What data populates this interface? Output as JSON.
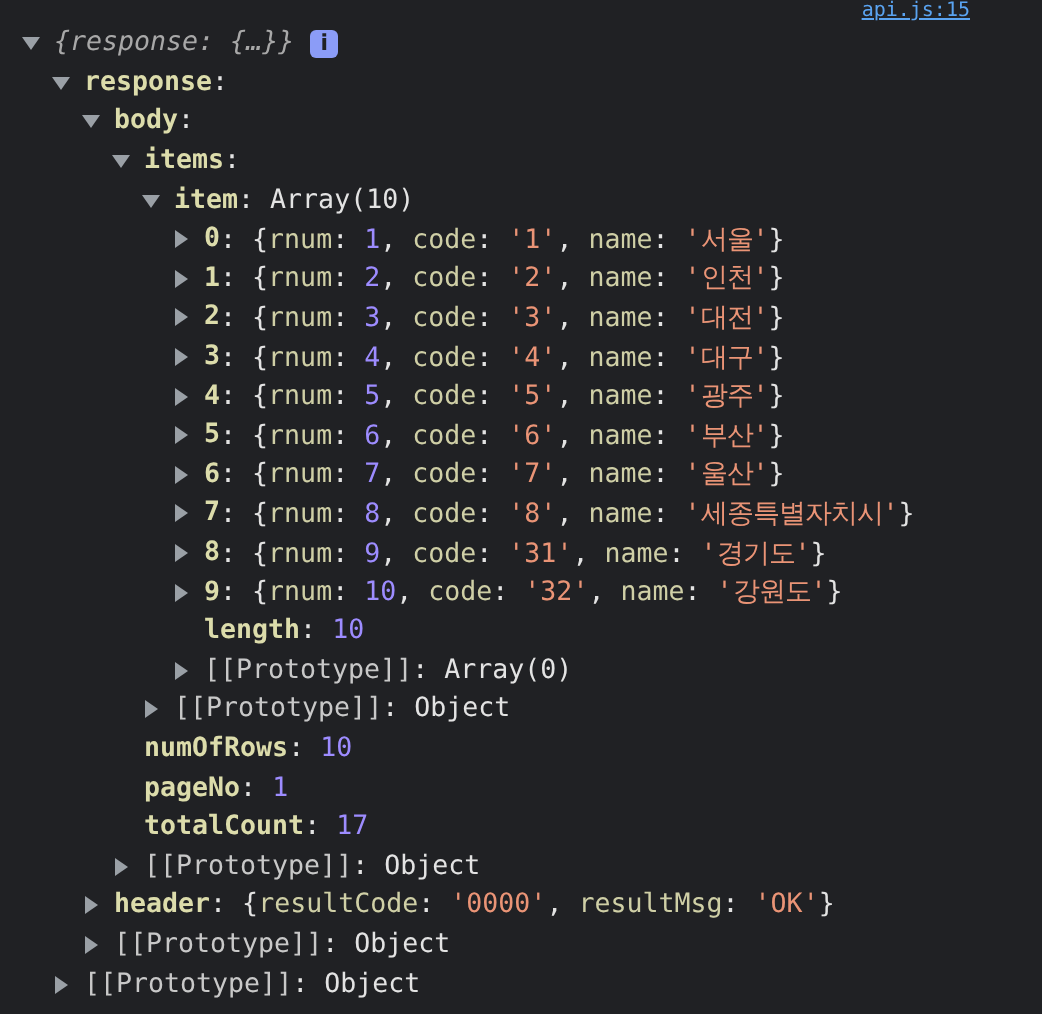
{
  "source_link": "api.js:15",
  "tree": {
    "summary": "{response: {…}}",
    "badge": "i",
    "expanded": true,
    "children": [
      {
        "kind": "node",
        "key": {
          "text": "response",
          "kind": "own"
        },
        "expanded": true,
        "value": [
          {
            "text": ":",
            "kind": "punct"
          }
        ],
        "children": [
          {
            "kind": "node",
            "key": {
              "text": "body",
              "kind": "own"
            },
            "expanded": true,
            "value": [
              {
                "text": ":",
                "kind": "punct"
              }
            ],
            "children": [
              {
                "kind": "node",
                "key": {
                  "text": "items",
                  "kind": "own"
                },
                "expanded": true,
                "value": [
                  {
                    "text": ":",
                    "kind": "punct"
                  }
                ],
                "children": [
                  {
                    "kind": "node",
                    "key": {
                      "text": "item",
                      "kind": "own"
                    },
                    "expanded": true,
                    "value": [
                      {
                        "text": ": Array(10)",
                        "kind": "punct"
                      }
                    ],
                    "children": [
                      {
                        "kind": "node",
                        "key": {
                          "text": "0",
                          "kind": "own"
                        },
                        "expanded": false,
                        "value": [
                          {
                            "text": ": {",
                            "kind": "punct"
                          },
                          {
                            "text": "rnum",
                            "kind": "prop"
                          },
                          {
                            "text": ": ",
                            "kind": "punct"
                          },
                          {
                            "text": "1",
                            "kind": "number"
                          },
                          {
                            "text": ", ",
                            "kind": "punct"
                          },
                          {
                            "text": "code",
                            "kind": "prop"
                          },
                          {
                            "text": ": ",
                            "kind": "punct"
                          },
                          {
                            "text": "'1'",
                            "kind": "string"
                          },
                          {
                            "text": ", ",
                            "kind": "punct"
                          },
                          {
                            "text": "name",
                            "kind": "prop"
                          },
                          {
                            "text": ": ",
                            "kind": "punct"
                          },
                          {
                            "text": "'서울'",
                            "kind": "string"
                          },
                          {
                            "text": "}",
                            "kind": "punct"
                          }
                        ]
                      },
                      {
                        "kind": "node",
                        "key": {
                          "text": "1",
                          "kind": "own"
                        },
                        "expanded": false,
                        "value": [
                          {
                            "text": ": {",
                            "kind": "punct"
                          },
                          {
                            "text": "rnum",
                            "kind": "prop"
                          },
                          {
                            "text": ": ",
                            "kind": "punct"
                          },
                          {
                            "text": "2",
                            "kind": "number"
                          },
                          {
                            "text": ", ",
                            "kind": "punct"
                          },
                          {
                            "text": "code",
                            "kind": "prop"
                          },
                          {
                            "text": ": ",
                            "kind": "punct"
                          },
                          {
                            "text": "'2'",
                            "kind": "string"
                          },
                          {
                            "text": ", ",
                            "kind": "punct"
                          },
                          {
                            "text": "name",
                            "kind": "prop"
                          },
                          {
                            "text": ": ",
                            "kind": "punct"
                          },
                          {
                            "text": "'인천'",
                            "kind": "string"
                          },
                          {
                            "text": "}",
                            "kind": "punct"
                          }
                        ]
                      },
                      {
                        "kind": "node",
                        "key": {
                          "text": "2",
                          "kind": "own"
                        },
                        "expanded": false,
                        "value": [
                          {
                            "text": ": {",
                            "kind": "punct"
                          },
                          {
                            "text": "rnum",
                            "kind": "prop"
                          },
                          {
                            "text": ": ",
                            "kind": "punct"
                          },
                          {
                            "text": "3",
                            "kind": "number"
                          },
                          {
                            "text": ", ",
                            "kind": "punct"
                          },
                          {
                            "text": "code",
                            "kind": "prop"
                          },
                          {
                            "text": ": ",
                            "kind": "punct"
                          },
                          {
                            "text": "'3'",
                            "kind": "string"
                          },
                          {
                            "text": ", ",
                            "kind": "punct"
                          },
                          {
                            "text": "name",
                            "kind": "prop"
                          },
                          {
                            "text": ": ",
                            "kind": "punct"
                          },
                          {
                            "text": "'대전'",
                            "kind": "string"
                          },
                          {
                            "text": "}",
                            "kind": "punct"
                          }
                        ]
                      },
                      {
                        "kind": "node",
                        "key": {
                          "text": "3",
                          "kind": "own"
                        },
                        "expanded": false,
                        "value": [
                          {
                            "text": ": {",
                            "kind": "punct"
                          },
                          {
                            "text": "rnum",
                            "kind": "prop"
                          },
                          {
                            "text": ": ",
                            "kind": "punct"
                          },
                          {
                            "text": "4",
                            "kind": "number"
                          },
                          {
                            "text": ", ",
                            "kind": "punct"
                          },
                          {
                            "text": "code",
                            "kind": "prop"
                          },
                          {
                            "text": ": ",
                            "kind": "punct"
                          },
                          {
                            "text": "'4'",
                            "kind": "string"
                          },
                          {
                            "text": ", ",
                            "kind": "punct"
                          },
                          {
                            "text": "name",
                            "kind": "prop"
                          },
                          {
                            "text": ": ",
                            "kind": "punct"
                          },
                          {
                            "text": "'대구'",
                            "kind": "string"
                          },
                          {
                            "text": "}",
                            "kind": "punct"
                          }
                        ]
                      },
                      {
                        "kind": "node",
                        "key": {
                          "text": "4",
                          "kind": "own"
                        },
                        "expanded": false,
                        "value": [
                          {
                            "text": ": {",
                            "kind": "punct"
                          },
                          {
                            "text": "rnum",
                            "kind": "prop"
                          },
                          {
                            "text": ": ",
                            "kind": "punct"
                          },
                          {
                            "text": "5",
                            "kind": "number"
                          },
                          {
                            "text": ", ",
                            "kind": "punct"
                          },
                          {
                            "text": "code",
                            "kind": "prop"
                          },
                          {
                            "text": ": ",
                            "kind": "punct"
                          },
                          {
                            "text": "'5'",
                            "kind": "string"
                          },
                          {
                            "text": ", ",
                            "kind": "punct"
                          },
                          {
                            "text": "name",
                            "kind": "prop"
                          },
                          {
                            "text": ": ",
                            "kind": "punct"
                          },
                          {
                            "text": "'광주'",
                            "kind": "string"
                          },
                          {
                            "text": "}",
                            "kind": "punct"
                          }
                        ]
                      },
                      {
                        "kind": "node",
                        "key": {
                          "text": "5",
                          "kind": "own"
                        },
                        "expanded": false,
                        "value": [
                          {
                            "text": ": {",
                            "kind": "punct"
                          },
                          {
                            "text": "rnum",
                            "kind": "prop"
                          },
                          {
                            "text": ": ",
                            "kind": "punct"
                          },
                          {
                            "text": "6",
                            "kind": "number"
                          },
                          {
                            "text": ", ",
                            "kind": "punct"
                          },
                          {
                            "text": "code",
                            "kind": "prop"
                          },
                          {
                            "text": ": ",
                            "kind": "punct"
                          },
                          {
                            "text": "'6'",
                            "kind": "string"
                          },
                          {
                            "text": ", ",
                            "kind": "punct"
                          },
                          {
                            "text": "name",
                            "kind": "prop"
                          },
                          {
                            "text": ": ",
                            "kind": "punct"
                          },
                          {
                            "text": "'부산'",
                            "kind": "string"
                          },
                          {
                            "text": "}",
                            "kind": "punct"
                          }
                        ]
                      },
                      {
                        "kind": "node",
                        "key": {
                          "text": "6",
                          "kind": "own"
                        },
                        "expanded": false,
                        "value": [
                          {
                            "text": ": {",
                            "kind": "punct"
                          },
                          {
                            "text": "rnum",
                            "kind": "prop"
                          },
                          {
                            "text": ": ",
                            "kind": "punct"
                          },
                          {
                            "text": "7",
                            "kind": "number"
                          },
                          {
                            "text": ", ",
                            "kind": "punct"
                          },
                          {
                            "text": "code",
                            "kind": "prop"
                          },
                          {
                            "text": ": ",
                            "kind": "punct"
                          },
                          {
                            "text": "'7'",
                            "kind": "string"
                          },
                          {
                            "text": ", ",
                            "kind": "punct"
                          },
                          {
                            "text": "name",
                            "kind": "prop"
                          },
                          {
                            "text": ": ",
                            "kind": "punct"
                          },
                          {
                            "text": "'울산'",
                            "kind": "string"
                          },
                          {
                            "text": "}",
                            "kind": "punct"
                          }
                        ]
                      },
                      {
                        "kind": "node",
                        "key": {
                          "text": "7",
                          "kind": "own"
                        },
                        "expanded": false,
                        "value": [
                          {
                            "text": ": {",
                            "kind": "punct"
                          },
                          {
                            "text": "rnum",
                            "kind": "prop"
                          },
                          {
                            "text": ": ",
                            "kind": "punct"
                          },
                          {
                            "text": "8",
                            "kind": "number"
                          },
                          {
                            "text": ", ",
                            "kind": "punct"
                          },
                          {
                            "text": "code",
                            "kind": "prop"
                          },
                          {
                            "text": ": ",
                            "kind": "punct"
                          },
                          {
                            "text": "'8'",
                            "kind": "string"
                          },
                          {
                            "text": ", ",
                            "kind": "punct"
                          },
                          {
                            "text": "name",
                            "kind": "prop"
                          },
                          {
                            "text": ": ",
                            "kind": "punct"
                          },
                          {
                            "text": "'세종특별자치시'",
                            "kind": "string"
                          },
                          {
                            "text": "}",
                            "kind": "punct"
                          }
                        ]
                      },
                      {
                        "kind": "node",
                        "key": {
                          "text": "8",
                          "kind": "own"
                        },
                        "expanded": false,
                        "value": [
                          {
                            "text": ": {",
                            "kind": "punct"
                          },
                          {
                            "text": "rnum",
                            "kind": "prop"
                          },
                          {
                            "text": ": ",
                            "kind": "punct"
                          },
                          {
                            "text": "9",
                            "kind": "number"
                          },
                          {
                            "text": ", ",
                            "kind": "punct"
                          },
                          {
                            "text": "code",
                            "kind": "prop"
                          },
                          {
                            "text": ": ",
                            "kind": "punct"
                          },
                          {
                            "text": "'31'",
                            "kind": "string"
                          },
                          {
                            "text": ", ",
                            "kind": "punct"
                          },
                          {
                            "text": "name",
                            "kind": "prop"
                          },
                          {
                            "text": ": ",
                            "kind": "punct"
                          },
                          {
                            "text": "'경기도'",
                            "kind": "string"
                          },
                          {
                            "text": "}",
                            "kind": "punct"
                          }
                        ]
                      },
                      {
                        "kind": "node",
                        "key": {
                          "text": "9",
                          "kind": "own"
                        },
                        "expanded": false,
                        "value": [
                          {
                            "text": ": {",
                            "kind": "punct"
                          },
                          {
                            "text": "rnum",
                            "kind": "prop"
                          },
                          {
                            "text": ": ",
                            "kind": "punct"
                          },
                          {
                            "text": "10",
                            "kind": "number"
                          },
                          {
                            "text": ", ",
                            "kind": "punct"
                          },
                          {
                            "text": "code",
                            "kind": "prop"
                          },
                          {
                            "text": ": ",
                            "kind": "punct"
                          },
                          {
                            "text": "'32'",
                            "kind": "string"
                          },
                          {
                            "text": ", ",
                            "kind": "punct"
                          },
                          {
                            "text": "name",
                            "kind": "prop"
                          },
                          {
                            "text": ": ",
                            "kind": "punct"
                          },
                          {
                            "text": "'강원도'",
                            "kind": "string"
                          },
                          {
                            "text": "}",
                            "kind": "punct"
                          }
                        ]
                      },
                      {
                        "kind": "leaf",
                        "key": {
                          "text": "length",
                          "kind": "own"
                        },
                        "value": [
                          {
                            "text": ": ",
                            "kind": "punct"
                          },
                          {
                            "text": "10",
                            "kind": "number"
                          }
                        ]
                      },
                      {
                        "kind": "node",
                        "key": {
                          "text": "[[Prototype]]",
                          "kind": "internal"
                        },
                        "expanded": false,
                        "value": [
                          {
                            "text": ": Array(0)",
                            "kind": "punct"
                          }
                        ]
                      }
                    ]
                  },
                  {
                    "kind": "node",
                    "key": {
                      "text": "[[Prototype]]",
                      "kind": "internal"
                    },
                    "expanded": false,
                    "value": [
                      {
                        "text": ": Object",
                        "kind": "punct"
                      }
                    ]
                  }
                ]
              },
              {
                "kind": "leaf",
                "key": {
                  "text": "numOfRows",
                  "kind": "own"
                },
                "value": [
                  {
                    "text": ": ",
                    "kind": "punct"
                  },
                  {
                    "text": "10",
                    "kind": "number"
                  }
                ]
              },
              {
                "kind": "leaf",
                "key": {
                  "text": "pageNo",
                  "kind": "own"
                },
                "value": [
                  {
                    "text": ": ",
                    "kind": "punct"
                  },
                  {
                    "text": "1",
                    "kind": "number"
                  }
                ]
              },
              {
                "kind": "leaf",
                "key": {
                  "text": "totalCount",
                  "kind": "own"
                },
                "value": [
                  {
                    "text": ": ",
                    "kind": "punct"
                  },
                  {
                    "text": "17",
                    "kind": "number"
                  }
                ]
              },
              {
                "kind": "node",
                "key": {
                  "text": "[[Prototype]]",
                  "kind": "internal"
                },
                "expanded": false,
                "value": [
                  {
                    "text": ": Object",
                    "kind": "punct"
                  }
                ]
              }
            ]
          },
          {
            "kind": "node",
            "key": {
              "text": "header",
              "kind": "own"
            },
            "expanded": false,
            "value": [
              {
                "text": ": {",
                "kind": "punct"
              },
              {
                "text": "resultCode",
                "kind": "prop"
              },
              {
                "text": ": ",
                "kind": "punct"
              },
              {
                "text": "'0000'",
                "kind": "string"
              },
              {
                "text": ", ",
                "kind": "punct"
              },
              {
                "text": "resultMsg",
                "kind": "prop"
              },
              {
                "text": ": ",
                "kind": "punct"
              },
              {
                "text": "'OK'",
                "kind": "string"
              },
              {
                "text": "}",
                "kind": "punct"
              }
            ]
          },
          {
            "kind": "node",
            "key": {
              "text": "[[Prototype]]",
              "kind": "internal"
            },
            "expanded": false,
            "value": [
              {
                "text": ": Object",
                "kind": "punct"
              }
            ]
          }
        ]
      },
      {
        "kind": "node",
        "key": {
          "text": "[[Prototype]]",
          "kind": "internal"
        },
        "expanded": false,
        "value": [
          {
            "text": ": Object",
            "kind": "punct"
          }
        ]
      }
    ]
  }
}
